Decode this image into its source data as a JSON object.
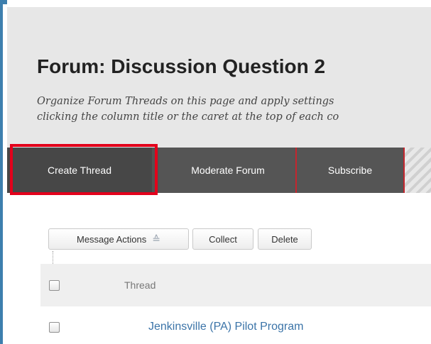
{
  "header": {
    "title": "Forum: Discussion Question 2",
    "description_line1": "Organize Forum Threads on this page and apply settings",
    "description_line2": "clicking the column title or the caret at the top of each co"
  },
  "toolbar": {
    "create_label": "Create Thread",
    "moderate_label": "Moderate Forum",
    "subscribe_label": "Subscribe"
  },
  "actions": {
    "message_actions_label": "Message Actions",
    "collect_label": "Collect",
    "delete_label": "Delete"
  },
  "table": {
    "column_thread": "Thread",
    "rows": [
      {
        "title": "Jenkinsville (PA) Pilot Program"
      }
    ]
  },
  "colors": {
    "accent_red": "#e3001b",
    "toolbar_bg": "#535353",
    "link_blue": "#3b74a8",
    "frame_blue": "#3d7fae"
  }
}
